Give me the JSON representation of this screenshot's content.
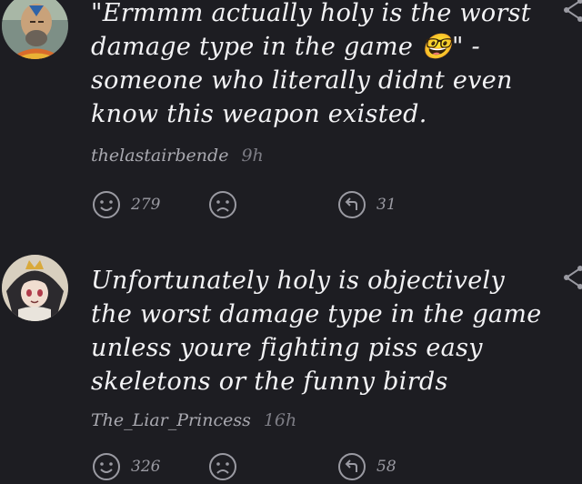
{
  "comments": [
    {
      "text": "\"Ermmm actually holy is the worst damage type in the game 🤓\" - someone who literally didnt even know this weapon existed.",
      "author": "thelastairbende",
      "age": "9h",
      "upvotes": "279",
      "replies": "31",
      "avatar_icon": "bald-monk-avatar"
    },
    {
      "text": "Unfortunately holy is objectively the worst damage type in the game unless youre fighting piss easy skeletons or the funny birds",
      "author": "The_Liar_Princess",
      "age": "16h",
      "upvotes": "326",
      "replies": "58",
      "avatar_icon": "anime-girl-crown-avatar"
    }
  ],
  "icons": {
    "upvote": "smile-face-icon",
    "downvote": "frown-face-icon",
    "reply": "reply-arrow-icon",
    "share": "share-icon"
  },
  "colors": {
    "background": "#1d1d22",
    "text": "#f3f3f5",
    "muted": "#a9a9b0"
  }
}
